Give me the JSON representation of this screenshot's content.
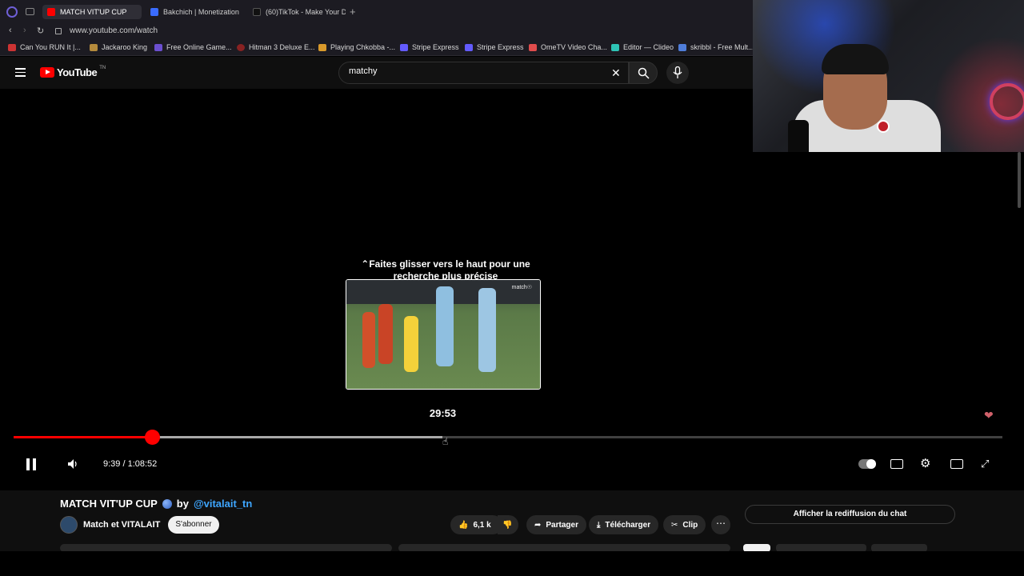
{
  "browser": {
    "tabs": [
      {
        "label": "MATCH VIT'UP CUP",
        "icon": "youtube-icon",
        "active": true
      },
      {
        "label": "Bakchich | Monetization",
        "icon": "bakchich-icon",
        "active": false
      },
      {
        "label": "(60)TikTok - Make Your D",
        "icon": "tiktok-icon",
        "active": false
      }
    ],
    "url": "www.youtube.com/watch",
    "bookmarks": [
      "Can You RUN It |...",
      "Jackaroo King",
      "Free Online Game...",
      "Hitman 3 Deluxe E...",
      "Playing Chkobba -...",
      "Stripe Express",
      "Stripe Express",
      "OmeTV Video Cha...",
      "Editor — Clideo",
      "skribbl - Free Mult..."
    ]
  },
  "youtube": {
    "logo_text": "YouTube",
    "logo_region": "TN",
    "search_value": "matchy"
  },
  "player": {
    "scroll_hint_line1": "Faites glisser vers le haut pour une",
    "scroll_hint_line2": "recherche plus précise",
    "preview_brand": "match☉",
    "preview_time": "29:53",
    "time_display": "9:39 / 1:08:52",
    "played_fraction": 0.1401,
    "hover_fraction": 0.4335
  },
  "video": {
    "title": "MATCH VIT'UP CUP",
    "by": "by",
    "handle": "@vitalait_tn",
    "channel_name": "Match et VITALAIT",
    "subscribe_label": "S'abonner",
    "likes": "6,1 k",
    "share_label": "Partager",
    "download_label": "Télécharger",
    "clip_label": "Clip",
    "chat_replay_label": "Afficher la rediffusion du chat"
  },
  "colors": {
    "accent": "#ff0000",
    "link": "#3ea6ff",
    "background": "#0f0f0f"
  }
}
